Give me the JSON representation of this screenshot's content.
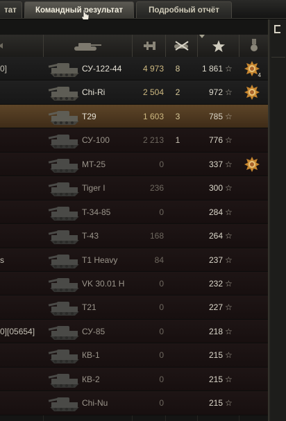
{
  "tabs": [
    {
      "label": "тат"
    },
    {
      "label": "Командный результат"
    },
    {
      "label": "Подробный отчёт"
    }
  ],
  "header_icons": [
    "tank-icon",
    "damage-icon",
    "kills-icon",
    "experience-star-icon",
    "medal-icon"
  ],
  "rows": [
    {
      "player_fragment": "0]",
      "tank": "СУ-122-44",
      "damage": "4 973",
      "kills": "8",
      "exp": "1 861",
      "status": "alive",
      "medal": true,
      "medal_count": "4"
    },
    {
      "player_fragment": "",
      "tank": "Chi-Ri",
      "damage": "2 504",
      "kills": "2",
      "exp": "972",
      "status": "alive",
      "medal": true,
      "medal_count": ""
    },
    {
      "player_fragment": "",
      "tank": "T29",
      "damage": "1 603",
      "kills": "3",
      "exp": "785",
      "status": "me",
      "medal": false,
      "medal_count": ""
    },
    {
      "player_fragment": "",
      "tank": "СУ-100",
      "damage": "2 213",
      "kills": "1",
      "exp": "776",
      "status": "dead",
      "medal": false,
      "medal_count": ""
    },
    {
      "player_fragment": "",
      "tank": "MT-25",
      "damage": "0",
      "kills": "",
      "exp": "337",
      "status": "dead",
      "medal": true,
      "medal_count": ""
    },
    {
      "player_fragment": "",
      "tank": "Tiger I",
      "damage": "236",
      "kills": "",
      "exp": "300",
      "status": "dead",
      "medal": false,
      "medal_count": ""
    },
    {
      "player_fragment": "",
      "tank": "T-34-85",
      "damage": "0",
      "kills": "",
      "exp": "284",
      "status": "dead",
      "medal": false,
      "medal_count": ""
    },
    {
      "player_fragment": "",
      "tank": "T-43",
      "damage": "168",
      "kills": "",
      "exp": "264",
      "status": "dead",
      "medal": false,
      "medal_count": ""
    },
    {
      "player_fragment": "s",
      "tank": "T1 Heavy",
      "damage": "84",
      "kills": "",
      "exp": "237",
      "status": "dead",
      "medal": false,
      "medal_count": ""
    },
    {
      "player_fragment": "",
      "tank": "VK 30.01 H",
      "damage": "0",
      "kills": "",
      "exp": "232",
      "status": "dead",
      "medal": false,
      "medal_count": ""
    },
    {
      "player_fragment": "",
      "tank": "T21",
      "damage": "0",
      "kills": "",
      "exp": "227",
      "status": "dead",
      "medal": false,
      "medal_count": ""
    },
    {
      "player_fragment": "0][05654]",
      "tank": "СУ-85",
      "damage": "0",
      "kills": "",
      "exp": "218",
      "status": "dead",
      "medal": false,
      "medal_count": ""
    },
    {
      "player_fragment": "",
      "tank": "КВ-1",
      "damage": "0",
      "kills": "",
      "exp": "215",
      "status": "dead",
      "medal": false,
      "medal_count": ""
    },
    {
      "player_fragment": "",
      "tank": "КВ-2",
      "damage": "0",
      "kills": "",
      "exp": "215",
      "status": "dead",
      "medal": false,
      "medal_count": ""
    },
    {
      "player_fragment": "",
      "tank": "Chi-Nu",
      "damage": "0",
      "kills": "",
      "exp": "215",
      "status": "dead",
      "medal": false,
      "medal_count": ""
    }
  ],
  "star_glyph": "☆",
  "colors": {
    "alive_damage": "#cdb880",
    "dead_row_tint": "#1e1515",
    "my_row_highlight": "#5d4528"
  }
}
